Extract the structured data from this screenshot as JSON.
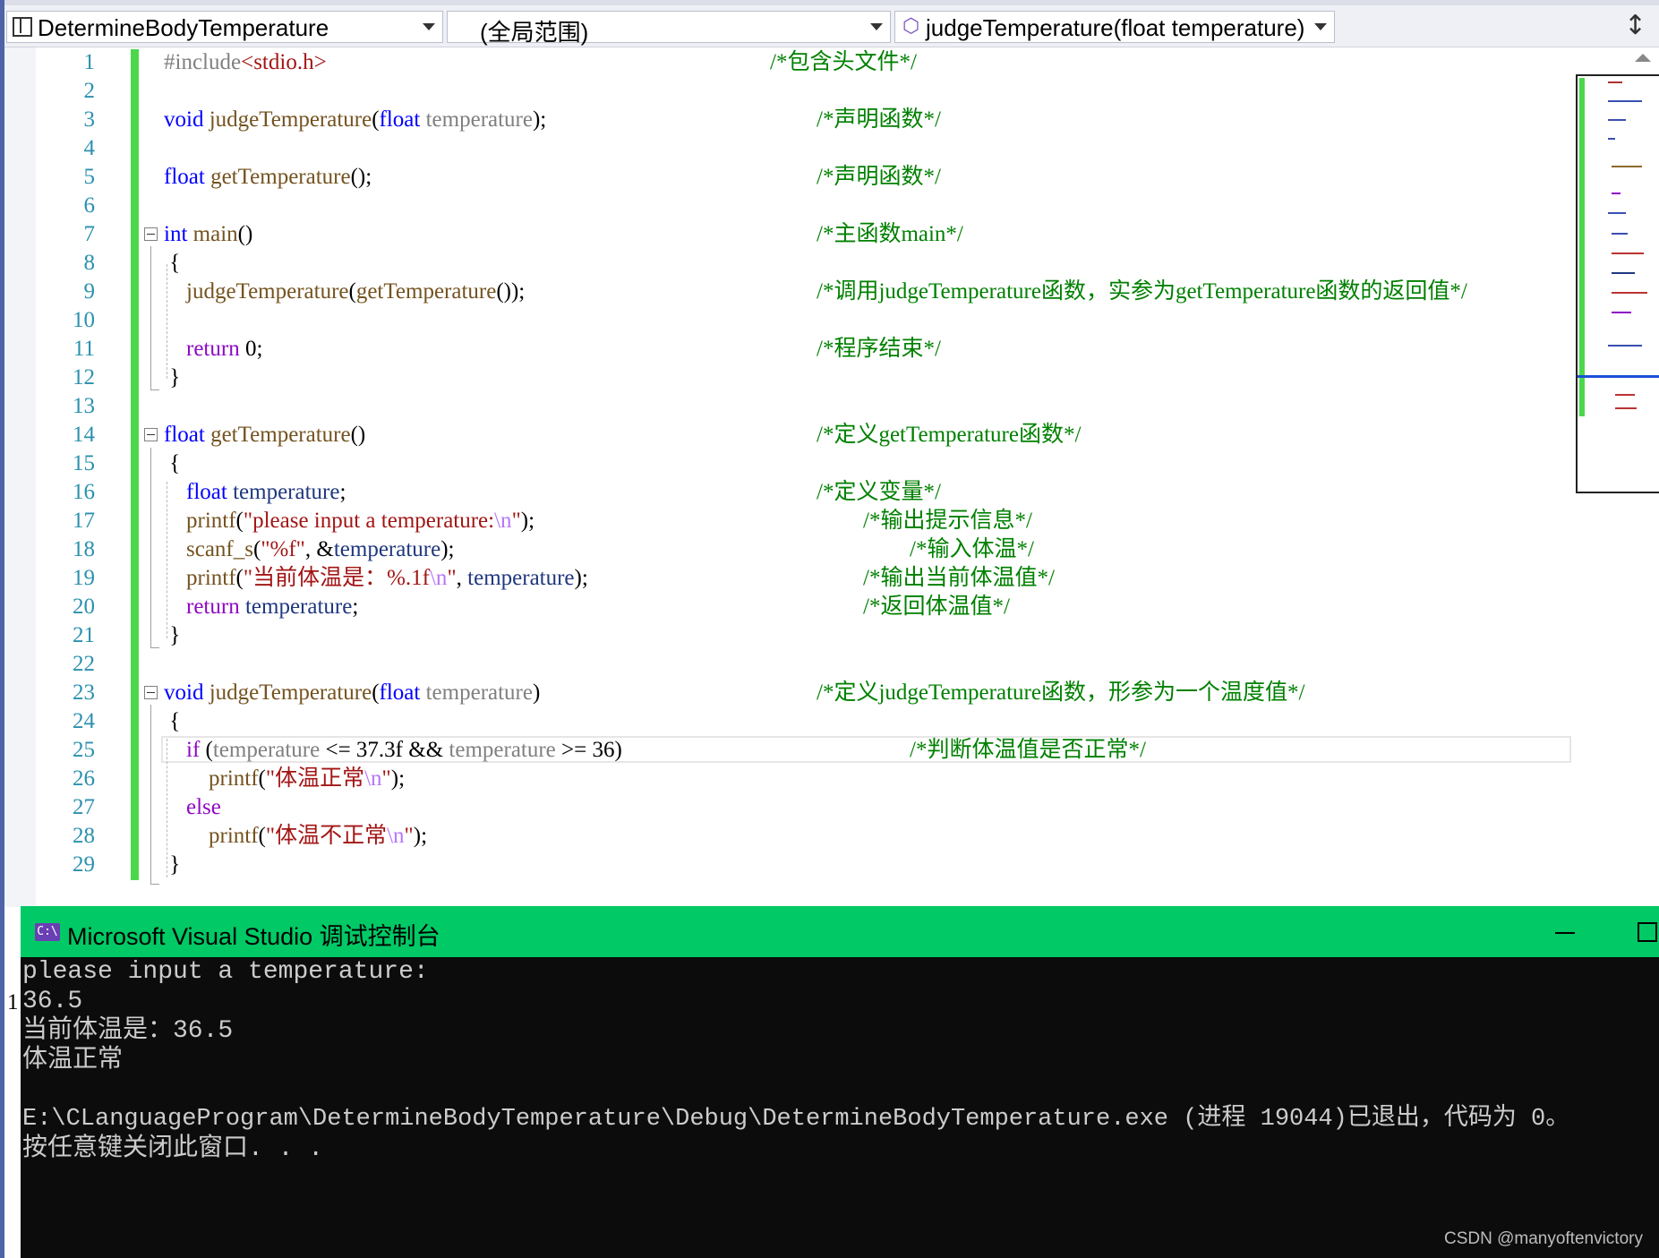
{
  "navbar": {
    "project_dropdown": "DetermineBodyTemperature",
    "scope_dropdown": "(全局范围)",
    "member_dropdown": "judgeTemperature(float temperature)"
  },
  "code_lines": [
    {
      "n": "1",
      "comment": "/*包含头文件*/"
    },
    {
      "n": "2"
    },
    {
      "n": "3",
      "comment": "/*声明函数*/"
    },
    {
      "n": "4"
    },
    {
      "n": "5",
      "comment": "/*声明函数*/"
    },
    {
      "n": "6"
    },
    {
      "n": "7",
      "comment": "/*主函数main*/"
    },
    {
      "n": "8"
    },
    {
      "n": "9",
      "comment": "/*调用judgeTemperature函数，实参为getTemperature函数的返回值*/"
    },
    {
      "n": "10"
    },
    {
      "n": "11",
      "comment": "/*程序结束*/"
    },
    {
      "n": "12"
    },
    {
      "n": "13"
    },
    {
      "n": "14",
      "comment": "/*定义getTemperature函数*/"
    },
    {
      "n": "15"
    },
    {
      "n": "16",
      "comment": "/*定义变量*/"
    },
    {
      "n": "17",
      "comment": "/*输出提示信息*/"
    },
    {
      "n": "18",
      "comment": "/*输入体温*/"
    },
    {
      "n": "19",
      "comment": "/*输出当前体温值*/"
    },
    {
      "n": "20",
      "comment": "/*返回体温值*/"
    },
    {
      "n": "21"
    },
    {
      "n": "22"
    },
    {
      "n": "23",
      "comment": "/*定义judgeTemperature函数，形参为一个温度值*/"
    },
    {
      "n": "24"
    },
    {
      "n": "25",
      "comment": "/*判断体温值是否正常*/"
    },
    {
      "n": "26"
    },
    {
      "n": "27"
    },
    {
      "n": "28"
    },
    {
      "n": "29"
    }
  ],
  "tokens": {
    "l1": {
      "inc": "#include",
      "hdr": "<stdio.h>"
    },
    "l3": {
      "kw1": "void",
      "fn": "judgeTemperature",
      "p1": "(",
      "kw2": "float",
      "prm": "temperature",
      "p2": ");"
    },
    "l5": {
      "kw": "float",
      "fn": "getTemperature",
      "p": "();"
    },
    "l7": {
      "kw": "int",
      "fn": "main",
      "p": "()"
    },
    "l8": {
      "p": "{"
    },
    "l9": {
      "fn1": "judgeTemperature",
      "p1": "(",
      "fn2": "getTemperature",
      "p2": "());"
    },
    "l11": {
      "kw": "return",
      "p": " 0;"
    },
    "l12": {
      "p": "}"
    },
    "l14": {
      "kw": "float",
      "fn": "getTemperature",
      "p": "()"
    },
    "l15": {
      "p": "{"
    },
    "l16": {
      "kw": "float",
      "var": "temperature",
      "p": ";"
    },
    "l17": {
      "fn": "printf",
      "p1": "(",
      "s1": "\"please input a temperature:",
      "e": "\\n",
      "s2": "\"",
      "p2": ");"
    },
    "l18": {
      "fn": "scanf_s",
      "p1": "(",
      "s": "\"%f\"",
      "p2": ", &",
      "var": "temperature",
      "p3": ");"
    },
    "l19": {
      "fn": "printf",
      "p1": "(",
      "s1": "\"当前体温是：%.1f",
      "e": "\\n",
      "s2": "\"",
      "p2": ", ",
      "var": "temperature",
      "p3": ");"
    },
    "l20": {
      "kw": "return",
      "var": "temperature",
      "p": ";"
    },
    "l21": {
      "p": "}"
    },
    "l23": {
      "kw1": "void",
      "fn": "judgeTemperature",
      "p1": "(",
      "kw2": "float",
      "prm": "temperature",
      "p2": ")"
    },
    "l24": {
      "p": "{"
    },
    "l25": {
      "kw": "if",
      "p1": " (",
      "prm1": "temperature",
      "p2": " <= 37.3f && ",
      "prm2": "temperature",
      "p3": " >= 36)"
    },
    "l26": {
      "fn": "printf",
      "p1": "(",
      "s1": "\"体温正常",
      "e": "\\n",
      "s2": "\"",
      "p2": ");"
    },
    "l27": {
      "kw": "else"
    },
    "l28": {
      "fn": "printf",
      "p1": "(",
      "s1": "\"体温不正常",
      "e": "\\n",
      "s2": "\"",
      "p2": ");"
    },
    "l29": {
      "p": "}"
    }
  },
  "console": {
    "title": "Microsoft Visual Studio 调试控制台",
    "icon_text": "C:\\",
    "lines": [
      "please input a temperature:",
      "36.5",
      "当前体温是：36.5",
      "体温正常",
      "",
      "E:\\CLanguageProgram\\DetermineBodyTemperature\\Debug\\DetermineBodyTemperature.exe (进程 19044)已退出，代码为 0。",
      "按任意键关闭此窗口. . ."
    ],
    "side_glyph": "1"
  },
  "watermark": "CSDN @manyoftenvictory",
  "colors": {
    "keyword": "#0000ff",
    "function": "#74531f",
    "comment": "#008000",
    "string": "#a31515",
    "console_title_bg": "#00c965",
    "console_bg": "#0c0c0c",
    "changed_bar": "#4ad84a"
  },
  "icons": {
    "project": "project-icon",
    "member": "cube-icon",
    "split": "split-window-icon"
  }
}
